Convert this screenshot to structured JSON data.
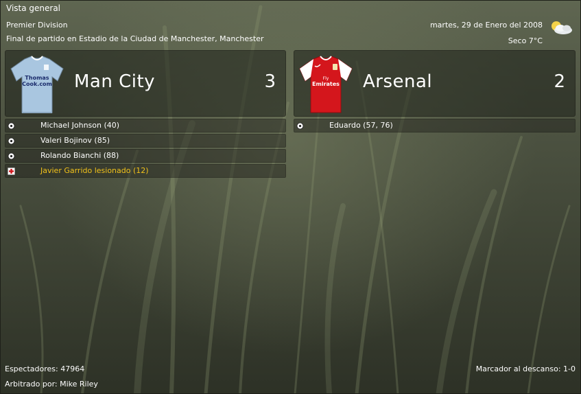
{
  "window": {
    "title": "Vista general"
  },
  "match": {
    "competition": "Premier Division",
    "venue": "Final de partido en Estadio de la Ciudad de Manchester, Manchester",
    "date": "martes, 29 de Enero del 2008",
    "weather": "Seco 7°C",
    "weather_icon": "partly-cloudy-icon"
  },
  "home": {
    "name": "Man City",
    "score": "3",
    "kit_color": "#a9c6e0",
    "events": [
      {
        "type": "goal",
        "icon": "ball-icon",
        "text": "Michael Johnson (40)"
      },
      {
        "type": "goal",
        "icon": "ball-icon",
        "text": "Valeri Bojinov (85)"
      },
      {
        "type": "goal",
        "icon": "ball-icon",
        "text": "Rolando Bianchi (88)"
      },
      {
        "type": "injury",
        "icon": "injury-icon",
        "text": "Javier Garrido lesionado (12)"
      }
    ]
  },
  "away": {
    "name": "Arsenal",
    "score": "2",
    "kit_color": "#d4161c",
    "events": [
      {
        "type": "goal",
        "icon": "ball-icon",
        "text": "Eduardo (57, 76)"
      }
    ]
  },
  "footer": {
    "attendance": "Espectadores: 47964",
    "referee": "Arbitrado por: Mike Riley",
    "halftime": "Marcador al descanso: 1-0"
  },
  "colors": {
    "injury_text": "#f2c21a",
    "panel_bg": "#1e201a"
  }
}
